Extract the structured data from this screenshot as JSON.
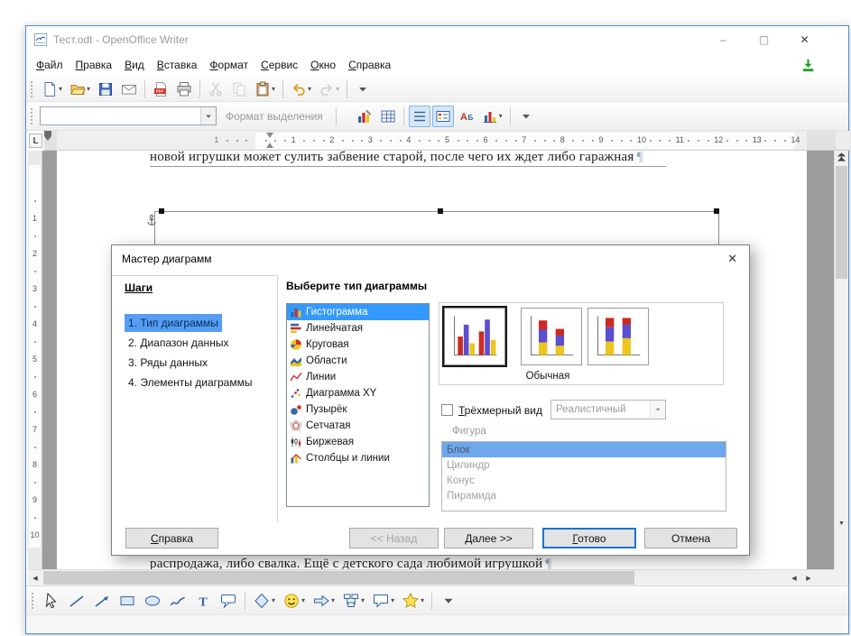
{
  "window": {
    "title": "Тест.odt - OpenOffice Writer"
  },
  "titlebar": {
    "minimize_label": "–",
    "maximize_label": "▢",
    "close_label": "✕"
  },
  "menubar": {
    "items": [
      "Файл",
      "Правка",
      "Вид",
      "Вставка",
      "Формат",
      "Сервис",
      "Окно",
      "Справка"
    ]
  },
  "toolbar_standard": {
    "items": [
      {
        "name": "new-document",
        "icon": "new-doc",
        "dropdown": true
      },
      {
        "name": "open",
        "icon": "open-folder",
        "dropdown": true
      },
      {
        "name": "save",
        "icon": "save"
      },
      {
        "name": "email",
        "icon": "email"
      },
      {
        "name": "sep"
      },
      {
        "name": "export-pdf",
        "icon": "pdf"
      },
      {
        "name": "print",
        "icon": "print"
      },
      {
        "name": "sep"
      },
      {
        "name": "cut",
        "icon": "cut",
        "disabled": true
      },
      {
        "name": "copy",
        "icon": "copy",
        "disabled": true
      },
      {
        "name": "paste",
        "icon": "paste",
        "dropdown": true
      },
      {
        "name": "sep"
      },
      {
        "name": "undo",
        "icon": "undo",
        "dropdown": true
      },
      {
        "name": "redo",
        "icon": "redo",
        "dropdown": true,
        "disabled": true
      },
      {
        "name": "sep"
      },
      {
        "name": "toolbar-overflow",
        "icon": "chevron-down"
      }
    ]
  },
  "toolbar_chart": {
    "combo_value": "",
    "format_selection_label": "Формат выделения",
    "items": [
      {
        "name": "chart-type",
        "icon": "chart-edit"
      },
      {
        "name": "data-table",
        "icon": "data-table"
      },
      {
        "name": "sep"
      },
      {
        "name": "horizontal-grid-toggle",
        "icon": "grid-lines",
        "pressed": true
      },
      {
        "name": "legend-toggle",
        "icon": "legend-box",
        "pressed": true
      },
      {
        "name": "scale-text",
        "icon": "scale-text"
      },
      {
        "name": "chart-gallery",
        "icon": "chart-bars",
        "dropdown": true
      },
      {
        "name": "sep"
      },
      {
        "name": "toolbar-overflow",
        "icon": "chevron-down"
      }
    ]
  },
  "ruler": {
    "tab_selector": "L",
    "h_margin_numbers": [
      "1"
    ],
    "h_numbers": [
      "1",
      "2",
      "3",
      "4",
      "5",
      "6",
      "7",
      "8",
      "9",
      "10",
      "11",
      "12",
      "13",
      "14"
    ],
    "v_numbers": [
      "1",
      "2",
      "3",
      "4",
      "5",
      "6",
      "7",
      "8",
      "9",
      "10"
    ]
  },
  "document": {
    "top_line": "новой игрушки может сулить забвение старой, после чего их ждет либо гаражная",
    "bottom_line": "распродажа, либо свалка. Ещё с детского сада любимой игрушкой",
    "pilcrow": "¶"
  },
  "dialog": {
    "title": "Мастер диаграмм",
    "close_label": "✕",
    "steps_header": "Шаги",
    "steps": [
      {
        "label": "1. Тип диаграммы",
        "selected": true
      },
      {
        "label": "2. Диапазон данных",
        "selected": false
      },
      {
        "label": "3. Ряды данных",
        "selected": false
      },
      {
        "label": "4. Элементы диаграммы",
        "selected": false
      }
    ],
    "choose_type_label": "Выберите тип диаграммы",
    "chart_types": [
      {
        "label": "Гистограмма",
        "icon": "type-bars",
        "selected": true
      },
      {
        "label": "Линейчатая",
        "icon": "type-hbars",
        "selected": false
      },
      {
        "label": "Круговая",
        "icon": "type-pie",
        "selected": false
      },
      {
        "label": "Области",
        "icon": "type-area",
        "selected": false
      },
      {
        "label": "Линии",
        "icon": "type-line",
        "selected": false
      },
      {
        "label": "Диаграмма XY",
        "icon": "type-xy",
        "selected": false
      },
      {
        "label": "Пузырёк",
        "icon": "type-bubble",
        "selected": false
      },
      {
        "label": "Сетчатая",
        "icon": "type-net",
        "selected": false
      },
      {
        "label": "Биржевая",
        "icon": "type-stock",
        "selected": false
      },
      {
        "label": "Столбцы и линии",
        "icon": "type-colline",
        "selected": false
      }
    ],
    "subtypes": [
      {
        "name": "normal",
        "selected": true
      },
      {
        "name": "stacked",
        "selected": false
      },
      {
        "name": "percent",
        "selected": false
      }
    ],
    "subtype_label": "Обычная",
    "three_d": {
      "label": "Трёхмерный вид",
      "checked": false,
      "scheme_value": "Реалистичный",
      "enabled": false
    },
    "shape_group": {
      "label": "Фигура",
      "enabled": false,
      "options": [
        {
          "label": "Блок",
          "selected": true
        },
        {
          "label": "Цилиндр",
          "selected": false
        },
        {
          "label": "Конус",
          "selected": false
        },
        {
          "label": "Пирамида",
          "selected": false
        }
      ]
    },
    "buttons": {
      "help": "Справка",
      "back": "<< Назад",
      "next": "Далее >>",
      "finish": "Готово",
      "cancel": "Отмена"
    }
  },
  "drawing_toolbar": {
    "tools": [
      {
        "name": "select",
        "icon": "pointer"
      },
      {
        "name": "line",
        "icon": "line"
      },
      {
        "name": "arrow",
        "icon": "arrow"
      },
      {
        "name": "rectangle",
        "icon": "rectangle"
      },
      {
        "name": "ellipse",
        "icon": "ellipse"
      },
      {
        "name": "freeform",
        "icon": "freeform"
      },
      {
        "name": "text",
        "icon": "text"
      },
      {
        "name": "callout",
        "icon": "callout"
      },
      {
        "name": "sep"
      },
      {
        "name": "basic-shapes",
        "icon": "diamond",
        "dropdown": true
      },
      {
        "name": "symbol-shapes",
        "icon": "smiley",
        "dropdown": true
      },
      {
        "name": "block-arrows",
        "icon": "block-arrow",
        "dropdown": true
      },
      {
        "name": "flowchart",
        "icon": "flowchart",
        "dropdown": true
      },
      {
        "name": "callouts",
        "icon": "callout2",
        "dropdown": true
      },
      {
        "name": "stars",
        "icon": "star",
        "dropdown": true
      },
      {
        "name": "sep"
      },
      {
        "name": "toolbar-overflow",
        "icon": "chevron-down"
      }
    ]
  },
  "scrollbars": {
    "up_arrow": "▲",
    "down_arrow": "▼",
    "left_arrow": "◀",
    "prev_arrow": "◀",
    "next_arrow": "▶"
  },
  "colors": {
    "selection_highlight": "#3399ff",
    "step_highlight": "#569df5",
    "default_button_border": "#1a74cf",
    "window_border": "#4a8fd3",
    "workspace_gray": "#9c9c9c"
  }
}
